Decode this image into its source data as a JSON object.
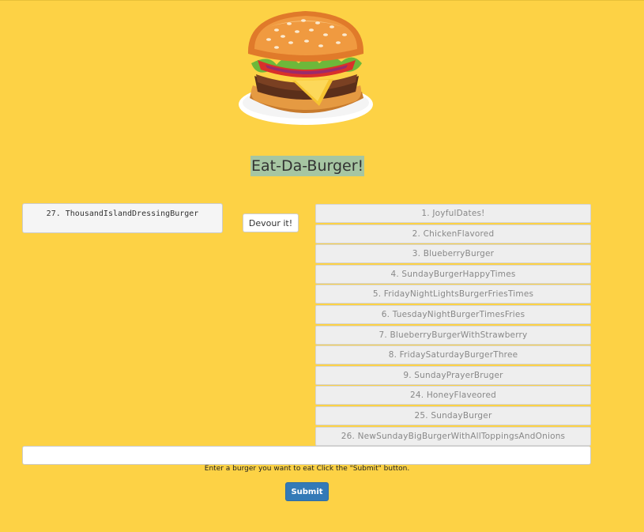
{
  "header": {
    "logo_icon": "burger-icon",
    "title": "Eat-Da-Burger!"
  },
  "devoured": {
    "items": [
      "27. ThousandIslandDressingBurger"
    ],
    "devour_label": "Devour it!"
  },
  "burgers": [
    "1. JoyfulDates!",
    "2. ChickenFlavored",
    "3. BlueberryBurger",
    "4. SundayBurgerHappyTimes",
    "5. FridayNightLightsBurgerFriesTimes",
    "6. TuesdayNightBurgerTimesFries",
    "7. BlueberryBurgerWithStrawberry",
    "8. FridaySaturdayBurgerThree",
    "9. SundayPrayerBruger",
    "24. HoneyFlaveored",
    "25. SundayBurger",
    "26. NewSundayBigBurgerWithAllToppingsAndOnions"
  ],
  "form": {
    "input_value": "",
    "helper_text": "Enter a burger you want to eat Click the \"Submit\" button.",
    "submit_label": "Submit"
  },
  "colors": {
    "background": "#fdd245",
    "title_highlight": "#a6c6a2",
    "submit": "#337ab7"
  }
}
